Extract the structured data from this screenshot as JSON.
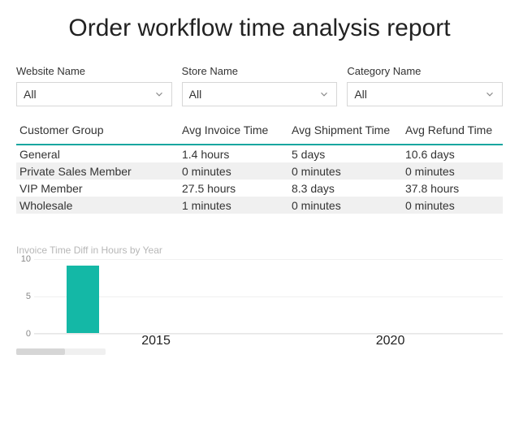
{
  "title": "Order workflow time analysis report",
  "filters": [
    {
      "label": "Website Name",
      "value": "All"
    },
    {
      "label": "Store Name",
      "value": "All"
    },
    {
      "label": "Category Name",
      "value": "All"
    }
  ],
  "table": {
    "headers": {
      "customer_group": "Customer Group",
      "avg_invoice": "Avg Invoice Time",
      "avg_shipment": "Avg Shipment Time",
      "avg_refund": "Avg Refund Time"
    },
    "rows": [
      {
        "group": "General",
        "invoice": "1.4 hours",
        "shipment": "5 days",
        "refund": "10.6 days"
      },
      {
        "group": "Private Sales Member",
        "invoice": "0 minutes",
        "shipment": "0 minutes",
        "refund": "0 minutes"
      },
      {
        "group": "VIP Member",
        "invoice": "27.5 hours",
        "shipment": "8.3 days",
        "refund": "37.8 hours"
      },
      {
        "group": "Wholesale",
        "invoice": "1 minutes",
        "shipment": "0 minutes",
        "refund": "0 minutes"
      }
    ]
  },
  "chart_data": {
    "type": "bar",
    "title": "Invoice Time Diff in Hours by Year",
    "categories": [
      "2015",
      "2020"
    ],
    "values": [
      9,
      0
    ],
    "ylim": [
      0,
      10
    ],
    "yticks": [
      0,
      5,
      10
    ],
    "xlabel": "",
    "ylabel": ""
  }
}
